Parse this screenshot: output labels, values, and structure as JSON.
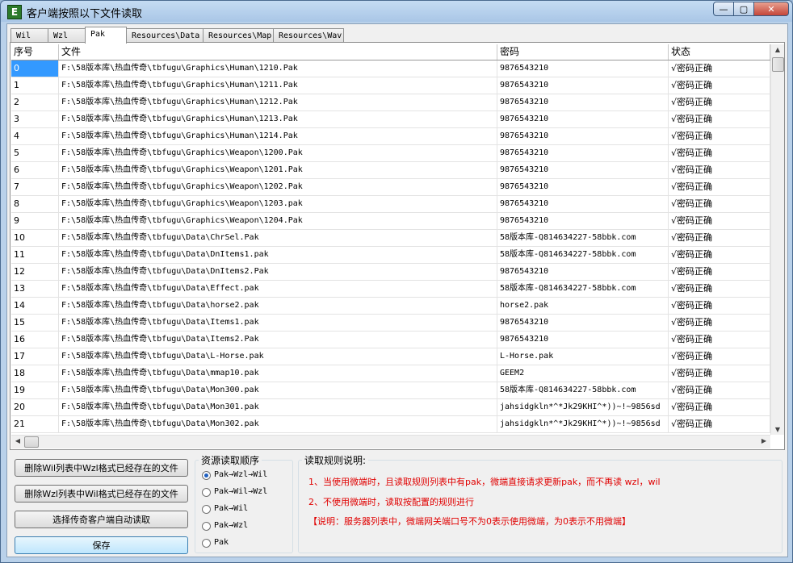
{
  "window": {
    "title": "客户端按照以下文件读取"
  },
  "window_buttons": {
    "min": "—",
    "max": "▢",
    "close": "✕"
  },
  "tabs": [
    {
      "label": "Wil"
    },
    {
      "label": "Wzl"
    },
    {
      "label": "Pak"
    },
    {
      "label": "Resources\\Data"
    },
    {
      "label": "Resources\\Map"
    },
    {
      "label": "Resources\\Wav"
    }
  ],
  "table": {
    "columns": [
      "序号",
      "文件",
      "密码",
      "状态"
    ],
    "rows": [
      [
        "0",
        "F:\\58版本库\\热血传奇\\tbfugu\\Graphics\\Human\\1210.Pak",
        "9876543210",
        "√密码正确"
      ],
      [
        "1",
        "F:\\58版本库\\热血传奇\\tbfugu\\Graphics\\Human\\1211.Pak",
        "9876543210",
        "√密码正确"
      ],
      [
        "2",
        "F:\\58版本库\\热血传奇\\tbfugu\\Graphics\\Human\\1212.Pak",
        "9876543210",
        "√密码正确"
      ],
      [
        "3",
        "F:\\58版本库\\热血传奇\\tbfugu\\Graphics\\Human\\1213.Pak",
        "9876543210",
        "√密码正确"
      ],
      [
        "4",
        "F:\\58版本库\\热血传奇\\tbfugu\\Graphics\\Human\\1214.Pak",
        "9876543210",
        "√密码正确"
      ],
      [
        "5",
        "F:\\58版本库\\热血传奇\\tbfugu\\Graphics\\Weapon\\1200.Pak",
        "9876543210",
        "√密码正确"
      ],
      [
        "6",
        "F:\\58版本库\\热血传奇\\tbfugu\\Graphics\\Weapon\\1201.Pak",
        "9876543210",
        "√密码正确"
      ],
      [
        "7",
        "F:\\58版本库\\热血传奇\\tbfugu\\Graphics\\Weapon\\1202.Pak",
        "9876543210",
        "√密码正确"
      ],
      [
        "8",
        "F:\\58版本库\\热血传奇\\tbfugu\\Graphics\\Weapon\\1203.pak",
        "9876543210",
        "√密码正确"
      ],
      [
        "9",
        "F:\\58版本库\\热血传奇\\tbfugu\\Graphics\\Weapon\\1204.Pak",
        "9876543210",
        "√密码正确"
      ],
      [
        "10",
        "F:\\58版本库\\热血传奇\\tbfugu\\Data\\ChrSel.Pak",
        "58版本库-Q814634227-58bbk.com",
        "√密码正确"
      ],
      [
        "11",
        "F:\\58版本库\\热血传奇\\tbfugu\\Data\\DnItems1.pak",
        "58版本库-Q814634227-58bbk.com",
        "√密码正确"
      ],
      [
        "12",
        "F:\\58版本库\\热血传奇\\tbfugu\\Data\\DnItems2.Pak",
        "9876543210",
        "√密码正确"
      ],
      [
        "13",
        "F:\\58版本库\\热血传奇\\tbfugu\\Data\\Effect.pak",
        "58版本库-Q814634227-58bbk.com",
        "√密码正确"
      ],
      [
        "14",
        "F:\\58版本库\\热血传奇\\tbfugu\\Data\\horse2.pak",
        "horse2.pak",
        "√密码正确"
      ],
      [
        "15",
        "F:\\58版本库\\热血传奇\\tbfugu\\Data\\Items1.pak",
        "9876543210",
        "√密码正确"
      ],
      [
        "16",
        "F:\\58版本库\\热血传奇\\tbfugu\\Data\\Items2.Pak",
        "9876543210",
        "√密码正确"
      ],
      [
        "17",
        "F:\\58版本库\\热血传奇\\tbfugu\\Data\\L-Horse.pak",
        "L-Horse.pak",
        "√密码正确"
      ],
      [
        "18",
        "F:\\58版本库\\热血传奇\\tbfugu\\Data\\mmap10.pak",
        "GEEM2",
        "√密码正确"
      ],
      [
        "19",
        "F:\\58版本库\\热血传奇\\tbfugu\\Data\\Mon300.pak",
        "58版本库-Q814634227-58bbk.com",
        "√密码正确"
      ],
      [
        "20",
        "F:\\58版本库\\热血传奇\\tbfugu\\Data\\Mon301.pak",
        "jahsidgkln*^*Jk29KHI^*))~!~9856sd",
        "√密码正确"
      ],
      [
        "21",
        "F:\\58版本库\\热血传奇\\tbfugu\\Data\\Mon302.pak",
        "jahsidgkln*^*Jk29KHI^*))~!~9856sd",
        "√密码正确"
      ]
    ]
  },
  "buttons": {
    "delete_wil": "删除Wil列表中Wzl格式已经存在的文件",
    "delete_wzl": "删除Wzl列表中Wil格式已经存在的文件",
    "auto_read": "选择传奇客户端自动读取",
    "save": "保存"
  },
  "order_group": {
    "label": "资源读取顺序",
    "options": [
      "Pak→Wzl→Wil",
      "Pak→Wil→Wzl",
      "Pak→Wil",
      "Pak→Wzl",
      "Pak"
    ],
    "selected": "Pak→Wzl→Wil"
  },
  "rules_group": {
    "label": "读取规则说明:",
    "lines": [
      "1、当使用微端时，且读取规则列表中有pak，微端直接请求更新pak，而不再读 wzl，wil",
      "2、不使用微端时，读取按配置的规则进行",
      "【说明：服务器列表中，微端网关端口号不为0表示使用微端，为0表示不用微端】"
    ]
  },
  "colors": {
    "title_bar": "#a9c6e6",
    "selection": "#3399ff",
    "rule_text": "#e00000"
  }
}
